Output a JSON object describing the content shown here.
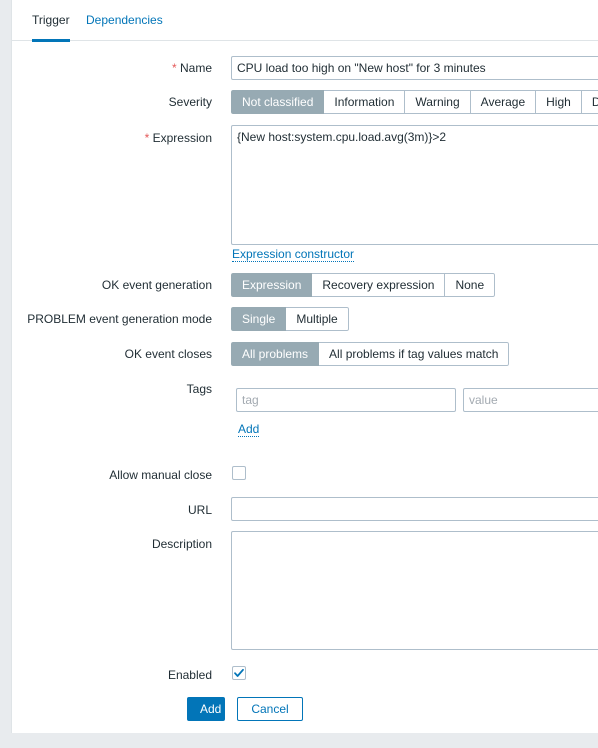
{
  "tabs": [
    {
      "label": "Trigger",
      "active": true
    },
    {
      "label": "Dependencies",
      "active": false
    }
  ],
  "form": {
    "name": {
      "label": "Name",
      "required": "*",
      "value": "CPU load too high on \"New host\" for 3 minutes"
    },
    "severity": {
      "label": "Severity",
      "options": [
        "Not classified",
        "Information",
        "Warning",
        "Average",
        "High",
        "Disaster"
      ],
      "selected": "Not classified"
    },
    "expression": {
      "label": "Expression",
      "required": "*",
      "value": "{New host:system.cpu.load.avg(3m)}>2",
      "constructor_link": "Expression constructor"
    },
    "ok_event_generation": {
      "label": "OK event generation",
      "options": [
        "Expression",
        "Recovery expression",
        "None"
      ],
      "selected": "Expression"
    },
    "problem_event_generation_mode": {
      "label": "PROBLEM event generation mode",
      "options": [
        "Single",
        "Multiple"
      ],
      "selected": "Single"
    },
    "ok_event_closes": {
      "label": "OK event closes",
      "options": [
        "All problems",
        "All problems if tag values match"
      ],
      "selected": "All problems"
    },
    "tags": {
      "label": "Tags",
      "tag_placeholder": "tag",
      "tag_value": "",
      "value_placeholder": "value",
      "value_value": "",
      "add_link": "Add"
    },
    "allow_manual_close": {
      "label": "Allow manual close",
      "checked": false
    },
    "url": {
      "label": "URL",
      "value": ""
    },
    "description": {
      "label": "Description",
      "value": ""
    },
    "enabled": {
      "label": "Enabled",
      "checked": true
    }
  },
  "footer": {
    "submit_label": "Add",
    "cancel_label": "Cancel"
  },
  "colors": {
    "accent": "#0275b8",
    "selected_segment": "#97aab3",
    "required_marker": "#e45959",
    "page_background": "#e8ebee",
    "border": "#aebecb"
  }
}
